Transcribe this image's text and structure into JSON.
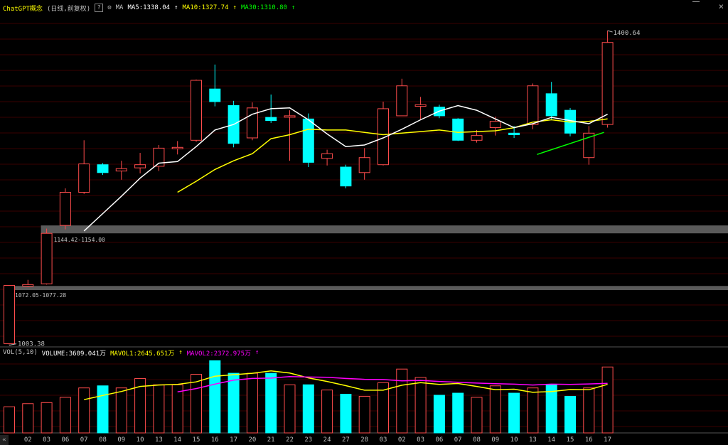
{
  "header": {
    "title": "ChatGPT概念",
    "mode": "(日线,前复权)",
    "help": "?",
    "ma_label": "MA",
    "ma5": "MA5:1338.04",
    "ma10": "MA10:1327.74",
    "ma30": "MA30:1310.80",
    "up_arrow": "↑",
    "close": "×"
  },
  "volume_header": {
    "label": "VOL(5,10)",
    "volume": "VOLUME:3609.041万",
    "mavol1": "MAVOL1:2645.651万",
    "mavol2": "MAVOL2:2372.975万",
    "up_arrow": "↑"
  },
  "annotations": {
    "high": "1400.64",
    "low": "1003.38",
    "gap_upper": "1144.42-1154.00",
    "gap_lower": "1072.05-1077.28"
  },
  "nav": {
    "left": "«"
  },
  "colors": {
    "up": "#ff4c4c",
    "down": "#00ffff",
    "ma5": "#ffffff",
    "ma10": "#ffff00",
    "ma30": "#00ff00",
    "mavol1": "#ffff00",
    "mavol2": "#ff00ff",
    "grid": "#3a0000",
    "gap": "#5a5a5a",
    "text": "#c0c0c0"
  },
  "chart_data": {
    "type": "candlestick",
    "price_range": [
      1000,
      1420
    ],
    "dates": [
      "",
      "02",
      "03",
      "06",
      "07",
      "08",
      "09",
      "10",
      "13",
      "14",
      "15",
      "16",
      "17",
      "20",
      "21",
      "22",
      "23",
      "24",
      "27",
      "28",
      "03",
      "02",
      "03",
      "06",
      "07",
      "08",
      "09",
      "10",
      "13",
      "14",
      "15",
      "16",
      "17"
    ],
    "candles": [
      {
        "o": 1004,
        "c": 1078,
        "h": 1078,
        "l": 1003
      },
      {
        "o": 1077,
        "c": 1079,
        "h": 1085,
        "l": 1076
      },
      {
        "o": 1080,
        "c": 1144,
        "h": 1150,
        "l": 1079
      },
      {
        "o": 1154,
        "c": 1196,
        "h": 1201,
        "l": 1149
      },
      {
        "o": 1196,
        "c": 1232,
        "h": 1262,
        "l": 1194
      },
      {
        "o": 1231,
        "c": 1221,
        "h": 1233,
        "l": 1218
      },
      {
        "o": 1223,
        "c": 1226,
        "h": 1236,
        "l": 1212
      },
      {
        "o": 1227,
        "c": 1231,
        "h": 1246,
        "l": 1220
      },
      {
        "o": 1229,
        "c": 1252,
        "h": 1256,
        "l": 1223
      },
      {
        "o": 1253,
        "c": 1253,
        "h": 1261,
        "l": 1244
      },
      {
        "o": 1262,
        "c": 1338,
        "h": 1339,
        "l": 1260
      },
      {
        "o": 1327,
        "c": 1311,
        "h": 1358,
        "l": 1305
      },
      {
        "o": 1306,
        "c": 1258,
        "h": 1312,
        "l": 1253
      },
      {
        "o": 1265,
        "c": 1303,
        "h": 1310,
        "l": 1262
      },
      {
        "o": 1291,
        "c": 1287,
        "h": 1320,
        "l": 1284
      },
      {
        "o": 1293,
        "c": 1293,
        "h": 1300,
        "l": 1236
      },
      {
        "o": 1289,
        "c": 1234,
        "h": 1296,
        "l": 1228
      },
      {
        "o": 1239,
        "c": 1245,
        "h": 1250,
        "l": 1230
      },
      {
        "o": 1228,
        "c": 1204,
        "h": 1231,
        "l": 1201
      },
      {
        "o": 1221,
        "c": 1240,
        "h": 1252,
        "l": 1212
      },
      {
        "o": 1231,
        "c": 1302,
        "h": 1311,
        "l": 1230
      },
      {
        "o": 1293,
        "c": 1331,
        "h": 1340,
        "l": 1293
      },
      {
        "o": 1305,
        "c": 1307,
        "h": 1317,
        "l": 1288
      },
      {
        "o": 1304,
        "c": 1293,
        "h": 1307,
        "l": 1290
      },
      {
        "o": 1289,
        "c": 1262,
        "h": 1290,
        "l": 1261
      },
      {
        "o": 1262,
        "c": 1268,
        "h": 1275,
        "l": 1259
      },
      {
        "o": 1278,
        "c": 1286,
        "h": 1292,
        "l": 1268
      },
      {
        "o": 1271,
        "c": 1269,
        "h": 1280,
        "l": 1265
      },
      {
        "o": 1282,
        "c": 1331,
        "h": 1334,
        "l": 1276
      },
      {
        "o": 1321,
        "c": 1293,
        "h": 1336,
        "l": 1288
      },
      {
        "o": 1300,
        "c": 1271,
        "h": 1303,
        "l": 1267
      },
      {
        "o": 1240,
        "c": 1271,
        "h": 1280,
        "l": 1231
      },
      {
        "o": 1282,
        "c": 1386,
        "h": 1401,
        "l": 1278
      }
    ],
    "ma5": [
      null,
      null,
      null,
      null,
      1147,
      1169,
      1191,
      1214,
      1233,
      1235,
      1254,
      1275,
      1282,
      1295,
      1302,
      1303,
      1288,
      1270,
      1254,
      1256,
      1265,
      1276,
      1288,
      1299,
      1306,
      1300,
      1289,
      1278,
      1283,
      1291,
      1287,
      1283,
      1295
    ],
    "ma10": [
      null,
      null,
      null,
      null,
      null,
      null,
      null,
      null,
      null,
      1196,
      1210,
      1225,
      1236,
      1245,
      1264,
      1269,
      1276,
      1275,
      1275,
      1272,
      1269,
      1271,
      1273,
      1275,
      1272,
      1273,
      1274,
      1278,
      1285,
      1288,
      1285,
      1286,
      1289
    ],
    "volume": [
      1250,
      1400,
      1450,
      1700,
      2150,
      2250,
      2150,
      2600,
      2300,
      2300,
      2800,
      3450,
      2850,
      2850,
      2850,
      2300,
      2300,
      2050,
      1850,
      1750,
      2400,
      3050,
      2650,
      1800,
      1900,
      1700,
      2250,
      1900,
      2150,
      2300,
      1750,
      2150,
      3150
    ],
    "mavol1": [
      null,
      null,
      null,
      null,
      1590,
      1790,
      1980,
      2220,
      2290,
      2320,
      2440,
      2710,
      2780,
      2850,
      2960,
      2860,
      2630,
      2460,
      2260,
      2040,
      2040,
      2280,
      2400,
      2320,
      2360,
      2220,
      2060,
      2090,
      1940,
      1980,
      2070,
      2060,
      2320
    ],
    "mavol2": [
      null,
      null,
      null,
      null,
      null,
      null,
      null,
      null,
      null,
      1960,
      2120,
      2330,
      2520,
      2600,
      2620,
      2690,
      2670,
      2660,
      2600,
      2560,
      2550,
      2490,
      2510,
      2460,
      2420,
      2380,
      2350,
      2330,
      2290,
      2330,
      2320,
      2340,
      2370
    ],
    "volume_range": [
      0,
      3600
    ]
  }
}
